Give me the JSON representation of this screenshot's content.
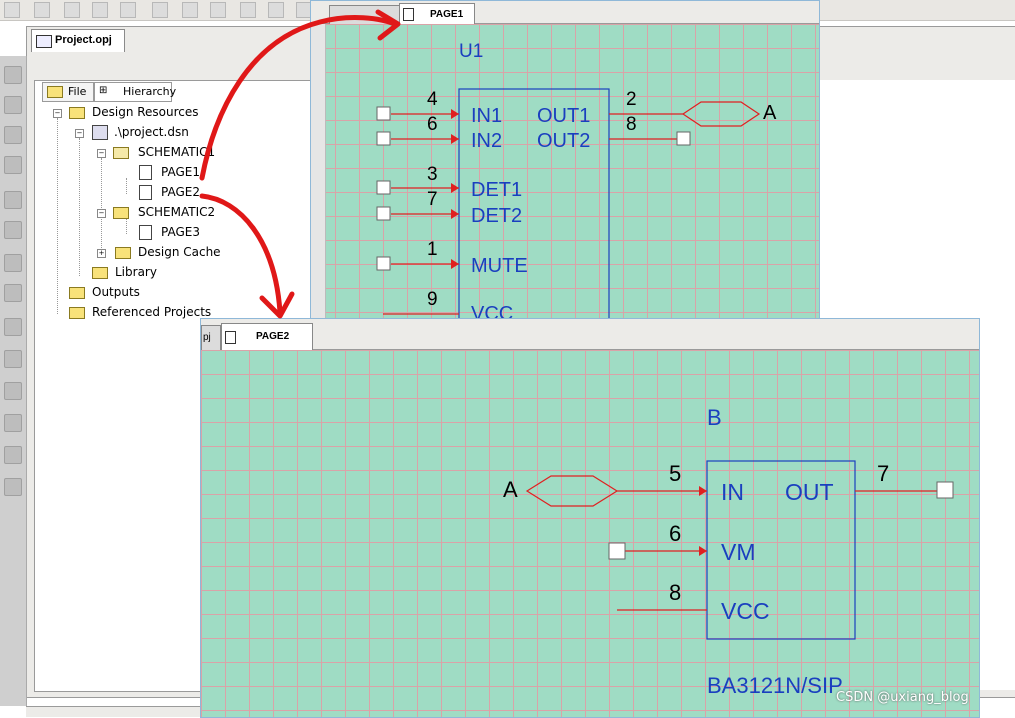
{
  "project_tab": "Project.opj",
  "panel_tabs": {
    "file": "File",
    "hierarchy": "Hierarchy"
  },
  "tree": {
    "design_resources": "Design Resources",
    "dsn": ".\\project.dsn",
    "schematic1": "SCHEMATIC1",
    "page1": "PAGE1",
    "page2": "PAGE2",
    "schematic2": "SCHEMATIC2",
    "page3": "PAGE3",
    "design_cache": "Design Cache",
    "library": "Library",
    "outputs": "Outputs",
    "referenced_projects": "Referenced Projects"
  },
  "page1_window": {
    "tab_label": "PAGE1",
    "ref": "U1",
    "pins_left": [
      {
        "num": "4",
        "name": "IN1"
      },
      {
        "num": "6",
        "name": "IN2"
      },
      {
        "num": "3",
        "name": "DET1"
      },
      {
        "num": "7",
        "name": "DET2"
      },
      {
        "num": "1",
        "name": "MUTE"
      },
      {
        "num": "9",
        "name": "VCC"
      }
    ],
    "pins_right": [
      {
        "num": "2",
        "name": "OUT1"
      },
      {
        "num": "8",
        "name": "OUT2"
      }
    ],
    "port_label": "A"
  },
  "page2_window": {
    "tab_prefix": "pj",
    "tab_label": "PAGE2",
    "ref": "B",
    "port_label": "A",
    "pins_left": [
      {
        "num": "5",
        "name": "IN"
      },
      {
        "num": "6",
        "name": "VM"
      },
      {
        "num": "8",
        "name": "VCC"
      }
    ],
    "pins_right": [
      {
        "num": "7",
        "name": "OUT"
      }
    ],
    "part_name": "BA3121N/SIP"
  },
  "watermark": "CSDN @uxiang_blog",
  "colors": {
    "schematic_bg": "#9fdcc4",
    "grid": "#d9a3a8",
    "part_outline": "#1a3fbf",
    "wire": "#e02020",
    "annotation_arrow": "#e01818"
  }
}
